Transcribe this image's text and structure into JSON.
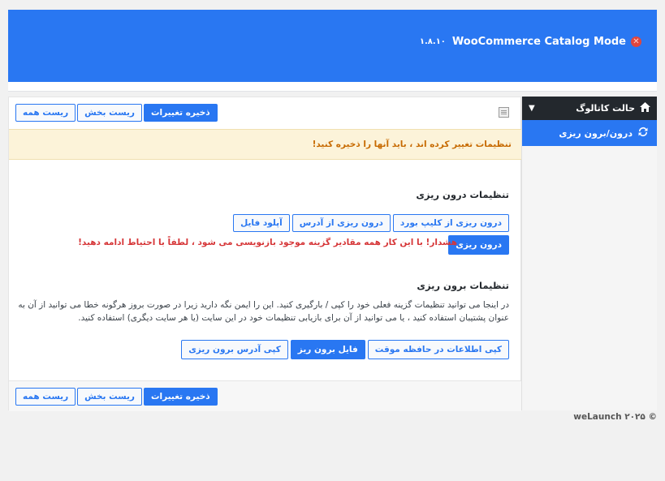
{
  "header": {
    "title": "WooCommerce Catalog Mode",
    "version": "۱.۸.۱۰"
  },
  "sidebar": {
    "items": [
      {
        "label": "حالت کاتالوگ",
        "icon": "home-icon",
        "active": false
      },
      {
        "label": "درون/برون ریزی",
        "icon": "refresh-icon",
        "active": true
      }
    ]
  },
  "toolbar": {
    "save_label": "ذخیره تغییرات",
    "reset_section_label": "ریست بخش",
    "reset_all_label": "ریست همه"
  },
  "notice": {
    "text": "تنظیمات تغییر کرده اند ، باید آنها را ذخیره کنید!"
  },
  "import": {
    "heading": "تنظیمات درون ریزی",
    "buttons": [
      "درون ریزی از کلیپ بورد",
      "درون ریزی از آدرس",
      "آپلود فایل"
    ],
    "import_button": "درون ریزی",
    "warning": "هشدار! با این کار همه مقادیر گزینه موجود بازنویسی می شود ، لطفاً با احتیاط ادامه دهید!"
  },
  "export": {
    "heading": "تنظیمات برون ریزی",
    "description": "در اینجا می توانید تنظیمات گزینه فعلی خود را کپی / بارگیری کنید. این را ایمن نگه دارید زیرا در صورت بروز هرگونه خطا می توانید از آن به عنوان پشتیبان استفاده کنید ، یا می توانید از آن برای بازیابی تنظیمات خود در این سایت (یا هر سایت دیگری) استفاده کنید.",
    "buttons": [
      "کپی اطلاعات در حافظه موقت",
      "فایل برون ریز",
      "کپی آدرس برون ریزی"
    ]
  },
  "credit": "weLaunch ۲۰۲۵ ©",
  "colors": {
    "accent": "#2977f2",
    "sidebar_dark": "#23282d",
    "warning": "#d63638",
    "notice_text": "#c76a00",
    "notice_bg": "#fcf3d9"
  }
}
